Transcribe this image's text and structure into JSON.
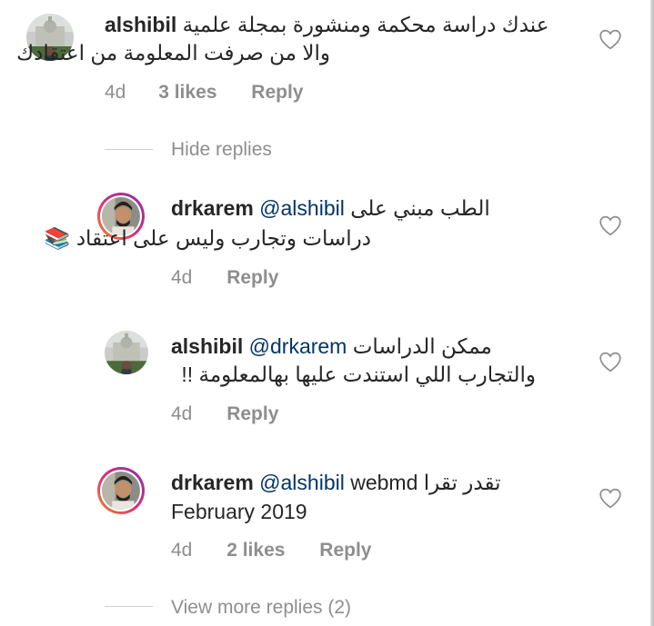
{
  "comments": [
    {
      "username": "alshibil",
      "line1_text": "عندك دراسة محكمة ومنشورة بمجلة علمية",
      "line2_text": "والا من صرفت المعلومة من اعتقادك",
      "time": "4d",
      "likes": "3 likes",
      "reply_label": "Reply"
    }
  ],
  "hide_replies_label": "Hide replies",
  "replies": [
    {
      "username": "drkarem",
      "mention": "@alshibil",
      "line1_text": "الطب مبني على",
      "line2_text": "دراسات وتجارب وليس على اعتقاد",
      "line2_suffix": "📚",
      "time": "4d",
      "reply_label": "Reply"
    },
    {
      "username": "alshibil",
      "mention": "@drkarem",
      "line1_text": "ممكن الدراسات",
      "line2_text": "والتجارب اللي استندت عليها بهالمعلومة !!",
      "time": "4d",
      "reply_label": "Reply"
    },
    {
      "username": "drkarem",
      "mention": "@alshibil",
      "line1_text": "تقدر تقرا webmd",
      "line2_text": "February 2019",
      "time": "4d",
      "likes": "2 likes",
      "reply_label": "Reply"
    }
  ],
  "view_more_label": "View more replies (2)",
  "icons": {
    "like": "heart-outline-icon"
  },
  "colors": {
    "mention": "#003569",
    "meta": "#8e8e8e",
    "text": "#262626"
  }
}
